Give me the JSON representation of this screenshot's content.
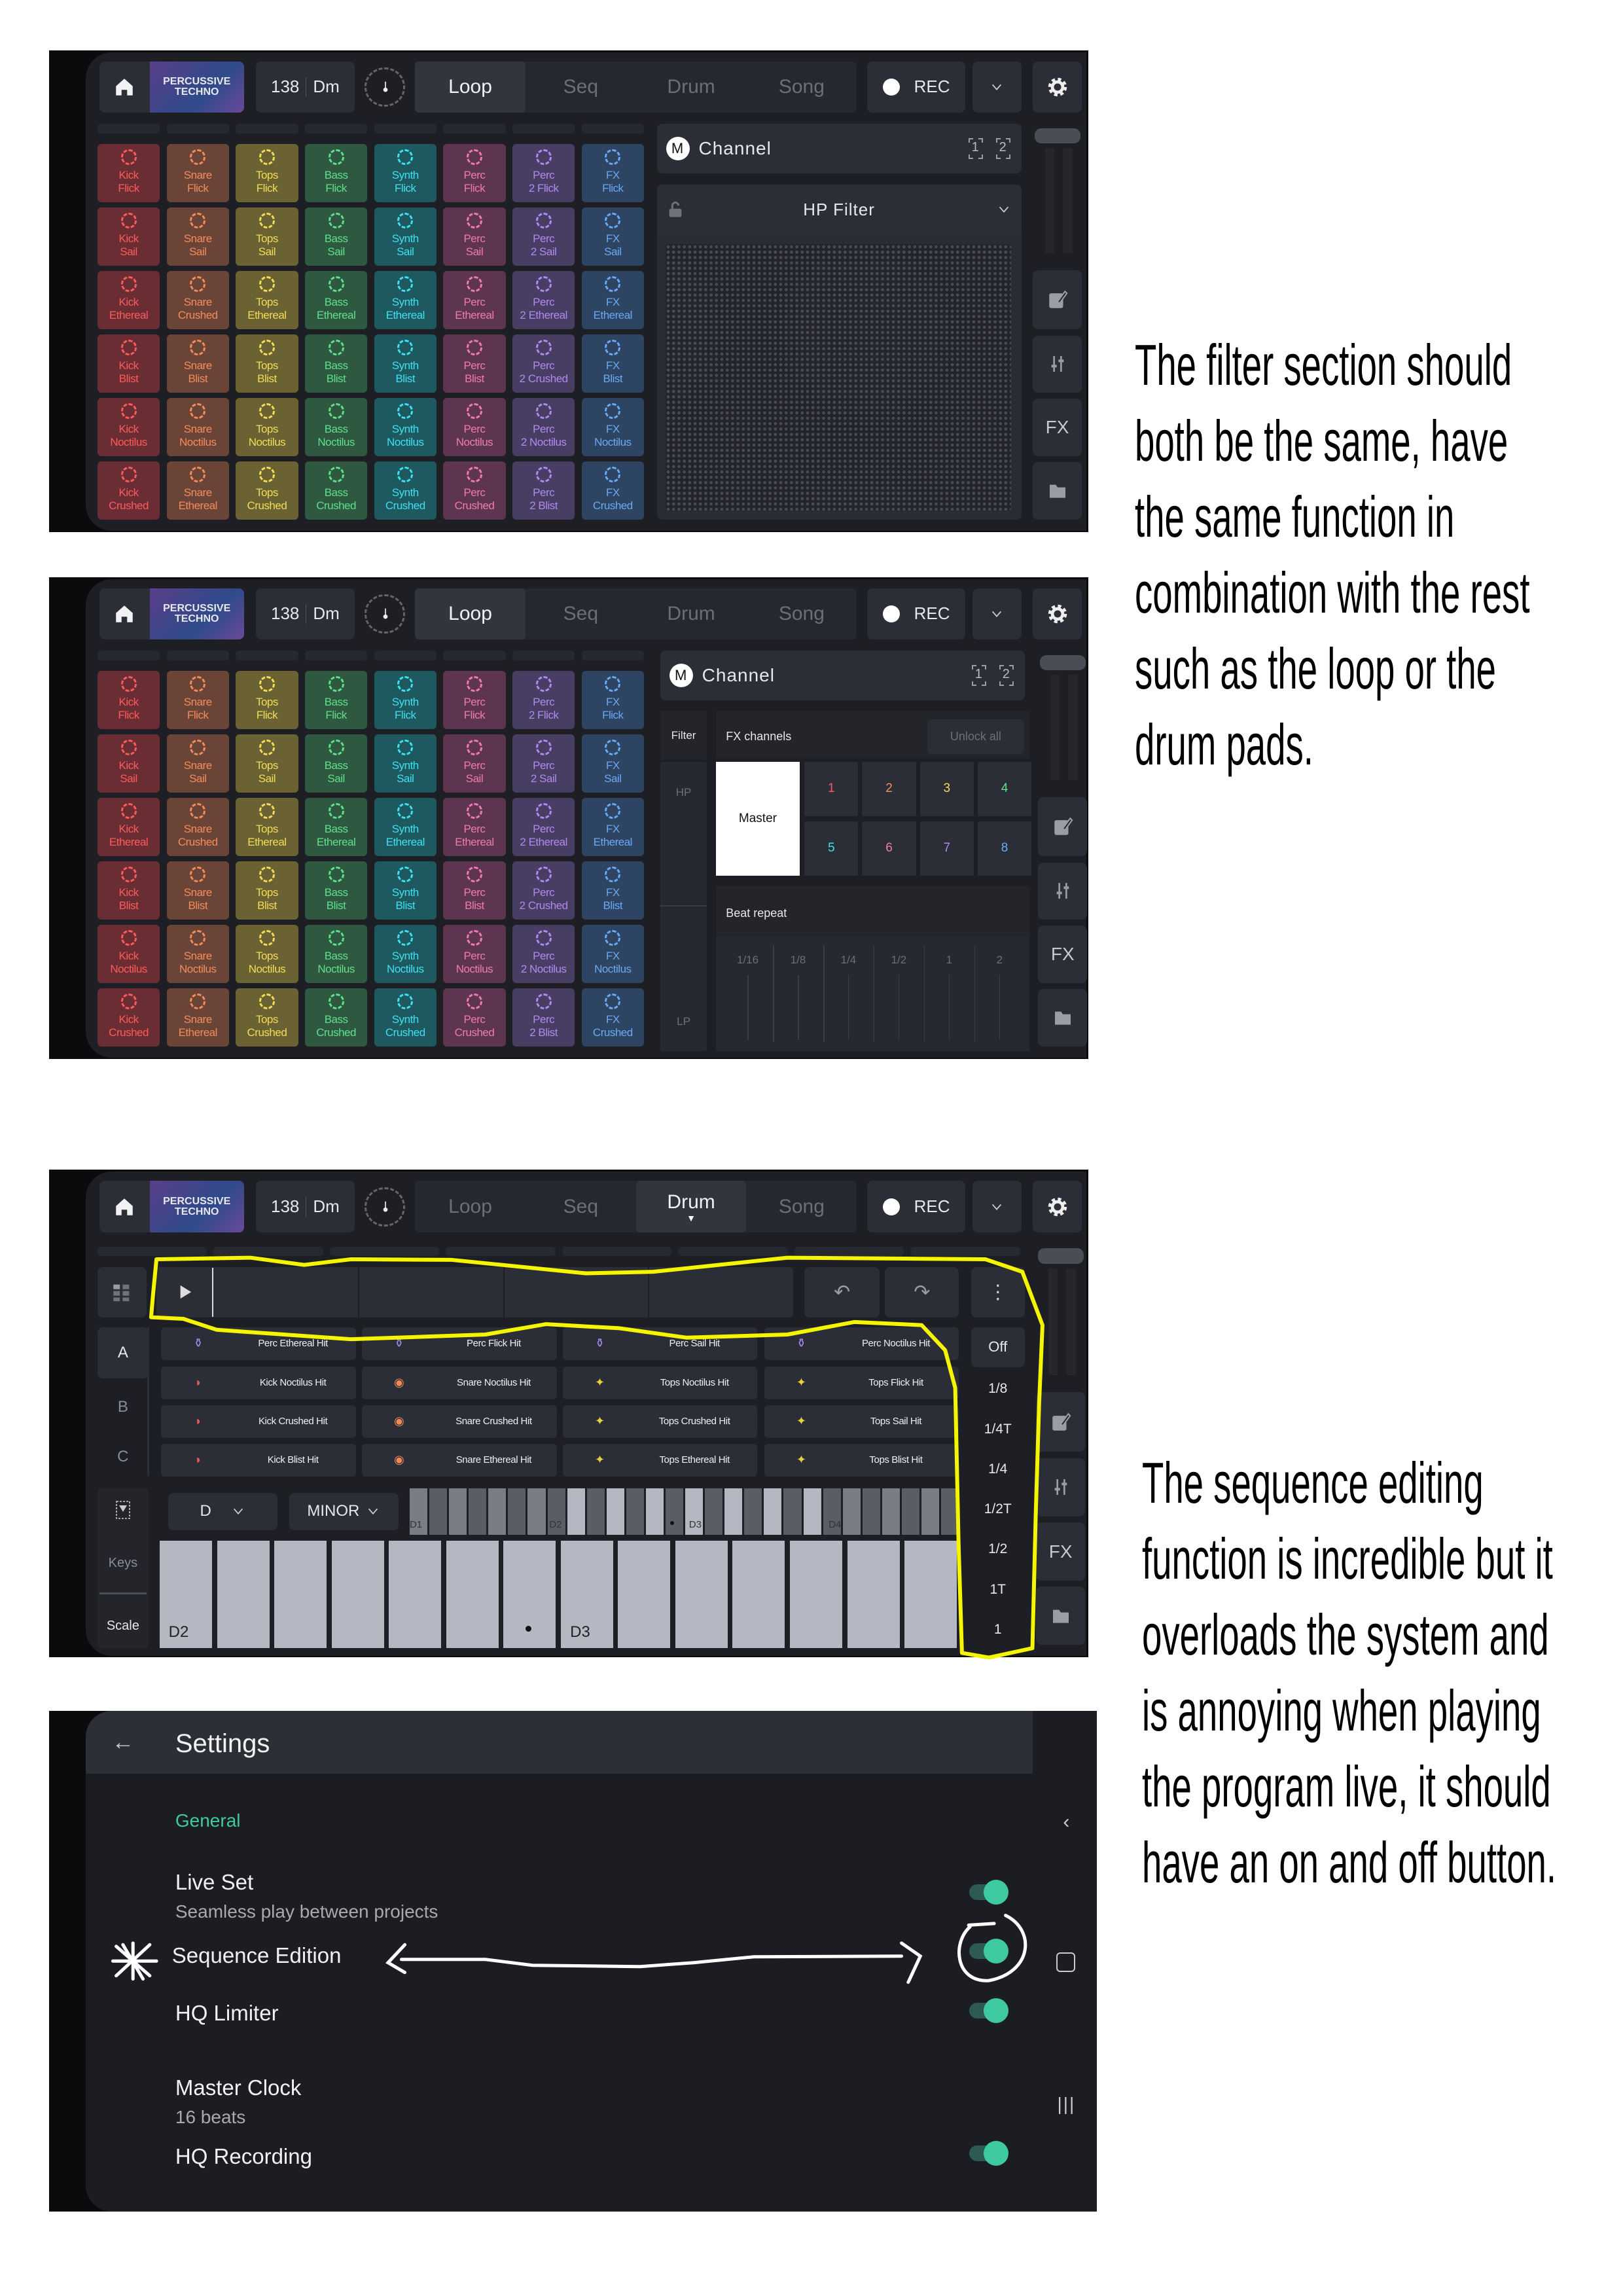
{
  "app_header": {
    "logo_text": [
      "PERCUSSIVE",
      "TECHNO"
    ],
    "bpm": "138",
    "key": "Dm",
    "tabs": [
      "Loop",
      "Seq",
      "Drum",
      "Song"
    ],
    "rec_label": "REC",
    "fx_label": "FX"
  },
  "colors": {
    "Kick": {
      "bg": "#6a2d33",
      "fg": "#ff5b5b"
    },
    "Snare": {
      "bg": "#6a4537",
      "fg": "#f58b5a"
    },
    "Tops": {
      "bg": "#6b6234",
      "fg": "#f3dc58"
    },
    "Bass": {
      "bg": "#2e5940",
      "fg": "#5fe08b"
    },
    "Synth": {
      "bg": "#1f5960",
      "fg": "#3fe0f0"
    },
    "Perc": {
      "bg": "#5d3550",
      "fg": "#f07ab2"
    },
    "Perc2": {
      "bg": "#483d62",
      "fg": "#b08af0"
    },
    "FX": {
      "bg": "#2d4462",
      "fg": "#6aaaf5"
    },
    "accent_green": "#3fc9a0",
    "annotation_yellow": "#f5f500"
  },
  "pad_grid": {
    "columns": [
      "Kick",
      "Snare",
      "Tops",
      "Bass",
      "Synth",
      "Perc",
      "Perc2",
      "FX"
    ],
    "rows": [
      [
        {
          "type": "Kick",
          "variant": "Flick"
        },
        {
          "type": "Snare",
          "variant": "Flick"
        },
        {
          "type": "Tops",
          "variant": "Flick"
        },
        {
          "type": "Bass",
          "variant": "Flick"
        },
        {
          "type": "Synth",
          "variant": "Flick"
        },
        {
          "type": "Perc",
          "variant": "Flick"
        },
        {
          "type": "Perc",
          "variant": "2 Flick"
        },
        {
          "type": "FX",
          "variant": "Flick"
        }
      ],
      [
        {
          "type": "Kick",
          "variant": "Sail"
        },
        {
          "type": "Snare",
          "variant": "Sail"
        },
        {
          "type": "Tops",
          "variant": "Sail"
        },
        {
          "type": "Bass",
          "variant": "Sail"
        },
        {
          "type": "Synth",
          "variant": "Sail"
        },
        {
          "type": "Perc",
          "variant": "Sail"
        },
        {
          "type": "Perc",
          "variant": "2 Sail"
        },
        {
          "type": "FX",
          "variant": "Sail"
        }
      ],
      [
        {
          "type": "Kick",
          "variant": "Ethereal"
        },
        {
          "type": "Snare",
          "variant": "Crushed"
        },
        {
          "type": "Tops",
          "variant": "Ethereal"
        },
        {
          "type": "Bass",
          "variant": "Ethereal"
        },
        {
          "type": "Synth",
          "variant": "Ethereal"
        },
        {
          "type": "Perc",
          "variant": "Ethereal"
        },
        {
          "type": "Perc",
          "variant": "2 Ethereal"
        },
        {
          "type": "FX",
          "variant": "Ethereal"
        }
      ],
      [
        {
          "type": "Kick",
          "variant": "Blist"
        },
        {
          "type": "Snare",
          "variant": "Blist"
        },
        {
          "type": "Tops",
          "variant": "Blist"
        },
        {
          "type": "Bass",
          "variant": "Blist"
        },
        {
          "type": "Synth",
          "variant": "Blist"
        },
        {
          "type": "Perc",
          "variant": "Blist"
        },
        {
          "type": "Perc",
          "variant": "2 Crushed"
        },
        {
          "type": "FX",
          "variant": "Blist"
        }
      ],
      [
        {
          "type": "Kick",
          "variant": "Noctilus"
        },
        {
          "type": "Snare",
          "variant": "Noctilus"
        },
        {
          "type": "Tops",
          "variant": "Noctilus"
        },
        {
          "type": "Bass",
          "variant": "Noctilus"
        },
        {
          "type": "Synth",
          "variant": "Noctilus"
        },
        {
          "type": "Perc",
          "variant": "Noctilus"
        },
        {
          "type": "Perc",
          "variant": "2 Noctilus"
        },
        {
          "type": "FX",
          "variant": "Noctilus"
        }
      ],
      [
        {
          "type": "Kick",
          "variant": "Crushed"
        },
        {
          "type": "Snare",
          "variant": "Ethereal"
        },
        {
          "type": "Tops",
          "variant": "Crushed"
        },
        {
          "type": "Bass",
          "variant": "Crushed"
        },
        {
          "type": "Synth",
          "variant": "Crushed"
        },
        {
          "type": "Perc",
          "variant": "Crushed"
        },
        {
          "type": "Perc",
          "variant": "2 Blist"
        },
        {
          "type": "FX",
          "variant": "Crushed"
        }
      ]
    ]
  },
  "channel": {
    "m_badge": "M",
    "title": "Channel",
    "slot1": "1",
    "slot2": "2"
  },
  "panel1": {
    "active_tab": "Loop",
    "filter_dropdown": "HP Filter"
  },
  "panel2": {
    "active_tab": "Loop",
    "filter_label": "Filter",
    "hp_label": "HP",
    "lp_label": "LP",
    "fx_channels_label": "FX channels",
    "unlock_all": "Unlock all",
    "master": "Master",
    "channels": [
      "1",
      "2",
      "3",
      "4",
      "5",
      "6",
      "7",
      "8"
    ],
    "channel_colors": [
      "#ff5b5b",
      "#f58b5a",
      "#f3dc58",
      "#5fe08b",
      "#3fe0f0",
      "#f07ab2",
      "#b08af0",
      "#6aaaf5"
    ],
    "beat_repeat_label": "Beat repeat",
    "beat_repeat_values": [
      "1/16",
      "1/8",
      "1/4",
      "1/2",
      "1",
      "2"
    ]
  },
  "panel3": {
    "active_tab": "Drum",
    "sections": [
      "A",
      "B",
      "C"
    ],
    "active_section": "A",
    "hit_pads": [
      [
        {
          "label": "Perc Ethereal Hit",
          "kind": "Perc"
        },
        {
          "label": "Perc Flick Hit",
          "kind": "Perc"
        },
        {
          "label": "Perc Sail Hit",
          "kind": "Perc"
        },
        {
          "label": "Perc Noctilus Hit",
          "kind": "Perc"
        }
      ],
      [
        {
          "label": "Kick Noctilus Hit",
          "kind": "Kick"
        },
        {
          "label": "Snare Noctilus Hit",
          "kind": "Snare"
        },
        {
          "label": "Tops Noctilus Hit",
          "kind": "Tops"
        },
        {
          "label": "Tops Flick Hit",
          "kind": "Tops"
        }
      ],
      [
        {
          "label": "Kick Crushed Hit",
          "kind": "Kick"
        },
        {
          "label": "Snare Crushed Hit",
          "kind": "Snare"
        },
        {
          "label": "Tops Crushed Hit",
          "kind": "Tops"
        },
        {
          "label": "Tops Sail Hit",
          "kind": "Tops"
        }
      ],
      [
        {
          "label": "Kick Blist Hit",
          "kind": "Kick"
        },
        {
          "label": "Snare Ethereal Hit",
          "kind": "Snare"
        },
        {
          "label": "Tops Ethereal Hit",
          "kind": "Tops"
        },
        {
          "label": "Tops Blist Hit",
          "kind": "Tops"
        }
      ]
    ],
    "hit_icons": {
      "Perc": "⚱",
      "Kick": "◗",
      "Snare": "◉",
      "Tops": "✦"
    },
    "hit_icon_colors": {
      "Perc": "#a98ae8",
      "Kick": "#e85a5a",
      "Snare": "#f08a5a",
      "Tops": "#e9d040"
    },
    "sync_values": [
      "Off",
      "1/8",
      "1/4T",
      "1/4",
      "1/2T",
      "1/2",
      "1T",
      "1"
    ],
    "root": "D",
    "scale": "MINOR",
    "keys_label": "Keys",
    "scale_label": "Scale",
    "mini_octaves": [
      "D1",
      "D2",
      "D3",
      "D4"
    ],
    "big_key_labels": [
      "D2",
      "D3"
    ]
  },
  "settings": {
    "title": "Settings",
    "section": "General",
    "items": [
      {
        "label": "Live Set",
        "sub": "Seamless play between projects",
        "toggle": true
      },
      {
        "label": "Sequence Edition",
        "toggle": true
      },
      {
        "label": "HQ Limiter",
        "toggle": true
      },
      {
        "label": "Master Clock",
        "sub": "16 beats"
      },
      {
        "label": "HQ Recording",
        "toggle": true
      }
    ]
  },
  "annotations": {
    "note1": [
      "The filter section should",
      "both be the same, have",
      "the same function in",
      "combination with the rest",
      "such as the loop or the",
      "drum pads."
    ],
    "note2": [
      "The sequence editing",
      "function is incredible but it",
      "overloads the system and",
      "is annoying when playing",
      "the program live, it should",
      "have an on and off button."
    ]
  }
}
